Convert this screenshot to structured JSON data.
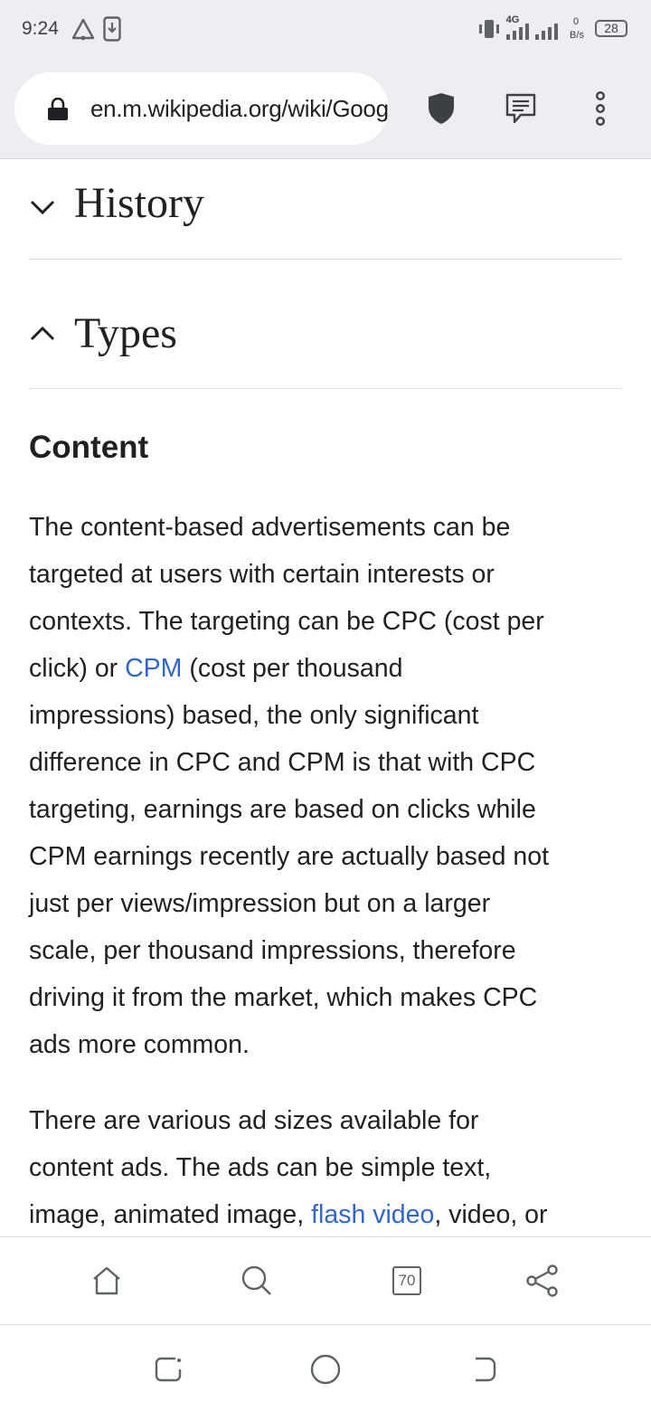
{
  "status_bar": {
    "time": "9:24",
    "network": "4G",
    "speed_value": "0",
    "speed_unit": "B/s",
    "battery": "28"
  },
  "toolbar": {
    "url": "en.m.wikipedia.org/wiki/Google_AdSense"
  },
  "article": {
    "sections": [
      {
        "title": "History",
        "state": "collapsed"
      },
      {
        "title": "Types",
        "state": "expanded"
      }
    ],
    "subheading": "Content",
    "p1": {
      "l1": "The content-based advertisements can be",
      "l2": "targeted at users with certain interests or",
      "l3": "contexts. The targeting can be CPC (cost per",
      "l4_pre": "click) or ",
      "l4_link": "CPM",
      "l4_post": " (cost per thousand",
      "l5": "impressions) based, the only significant",
      "l6": "difference in CPC and CPM is that with CPC",
      "l7": "targeting, earnings are based on clicks while",
      "l8": "CPM earnings recently are actually based not",
      "l9": "just per views/impression but on a larger",
      "l10": "scale, per thousand impressions, therefore",
      "l11": "driving it from the market, which makes CPC",
      "l12": "ads more common."
    },
    "p2": {
      "l1": "There are various ad sizes available for",
      "l2": "content ads. The ads can be simple text,",
      "l3_pre": "image, animated image, ",
      "l3_link": "flash video",
      "l3_post": ", video, or"
    }
  },
  "bottom_bar": {
    "tab_count": "70",
    "icons": [
      "home-icon",
      "search-icon",
      "tabs-icon",
      "share-icon"
    ]
  },
  "colors": {
    "link": "#3366cc",
    "chrome_bg": "#eceef2",
    "text": "#202122"
  }
}
